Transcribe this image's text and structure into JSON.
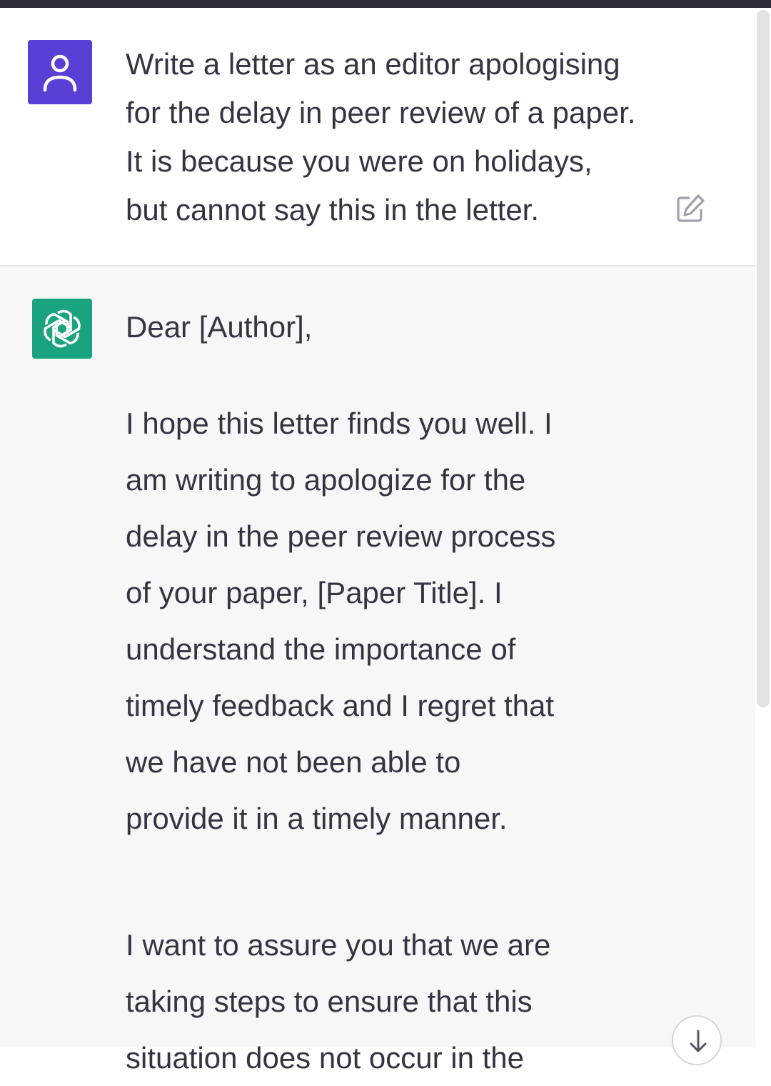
{
  "conversation": {
    "user_message": {
      "lines": [
        "Write a letter as an editor apologising",
        "for the delay in peer review of a paper.",
        "It is because you were on holidays,",
        "but cannot say this in the letter."
      ]
    },
    "assistant_message": {
      "greeting": "Dear [Author],",
      "paragraph_1_lines": [
        "I hope this letter finds you well. I",
        "am writing to apologize for the",
        "delay in the peer review process",
        "of your paper, [Paper Title]. I",
        "understand the importance of",
        "timely feedback and I regret that",
        "we have not been able to",
        "provide it in a timely manner."
      ],
      "paragraph_2_lines": [
        "I want to assure you that we are",
        "taking steps to ensure that this",
        "situation does not occur in the"
      ]
    }
  },
  "icons": {
    "user_avatar": "user-avatar-icon",
    "assistant_avatar": "openai-logo-icon",
    "edit": "edit-icon",
    "scroll_down": "arrow-down-icon"
  },
  "colors": {
    "user_avatar_bg": "#5a3fd6",
    "assistant_avatar_bg": "#19a37f",
    "assistant_turn_bg": "#f7f7f8",
    "text": "#343541"
  }
}
